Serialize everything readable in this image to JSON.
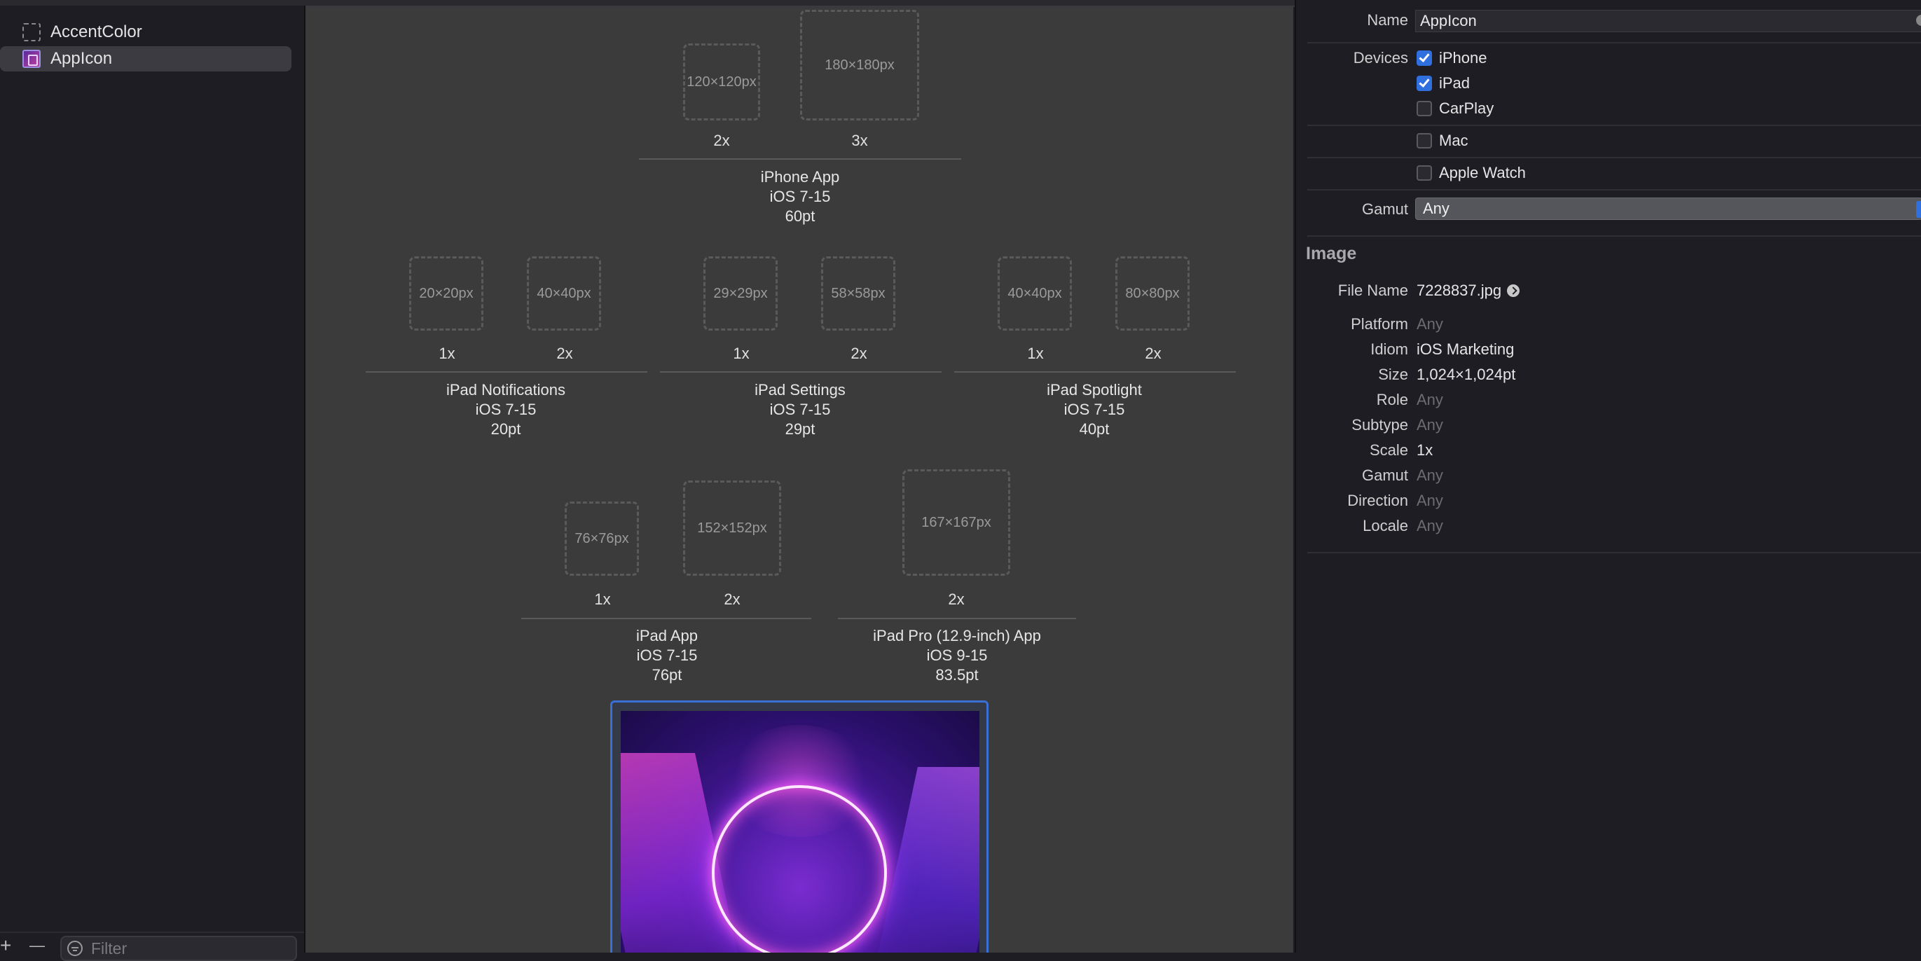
{
  "sidebar": {
    "items": [
      {
        "label": "AccentColor",
        "icon": "color-set-icon"
      },
      {
        "label": "AppIcon",
        "icon": "app-icon-set-icon"
      }
    ],
    "add": "+",
    "remove": "—",
    "filter_placeholder": "Filter"
  },
  "canvas": {
    "slots": [
      {
        "size": "120×120px",
        "scale": "2x"
      },
      {
        "size": "180×180px",
        "scale": "3x"
      },
      {
        "size": "20×20px",
        "scale": "1x"
      },
      {
        "size": "40×40px",
        "scale": "2x"
      },
      {
        "size": "29×29px",
        "scale": "1x"
      },
      {
        "size": "58×58px",
        "scale": "2x"
      },
      {
        "size": "40×40px",
        "scale": "1x"
      },
      {
        "size": "80×80px",
        "scale": "2x"
      },
      {
        "size": "76×76px",
        "scale": "1x"
      },
      {
        "size": "152×152px",
        "scale": "2x"
      },
      {
        "size": "167×167px",
        "scale": "2x"
      }
    ],
    "groups": [
      {
        "name": "iPhone App",
        "os": "iOS 7-15",
        "pt": "60pt"
      },
      {
        "name": "iPad Notifications",
        "os": "iOS 7-15",
        "pt": "20pt"
      },
      {
        "name": "iPad Settings",
        "os": "iOS 7-15",
        "pt": "29pt"
      },
      {
        "name": "iPad Spotlight",
        "os": "iOS 7-15",
        "pt": "40pt"
      },
      {
        "name": "iPad App",
        "os": "iOS 7-15",
        "pt": "76pt"
      },
      {
        "name": "iPad Pro (12.9-inch) App",
        "os": "iOS 9-15",
        "pt": "83.5pt"
      }
    ]
  },
  "inspector": {
    "name_label": "Name",
    "name_value": "AppIcon",
    "devices_label": "Devices",
    "devices": [
      {
        "label": "iPhone",
        "checked": true
      },
      {
        "label": "iPad",
        "checked": true
      },
      {
        "label": "CarPlay",
        "checked": false
      },
      {
        "label": "Mac",
        "checked": false
      },
      {
        "label": "Apple Watch",
        "checked": false
      }
    ],
    "gamut_label": "Gamut",
    "gamut_value": "Any",
    "image_section": "Image",
    "image_fields": [
      {
        "label": "File Name",
        "value": "7228837.jpg",
        "muted": false
      },
      {
        "label": "Platform",
        "value": "Any",
        "muted": true
      },
      {
        "label": "Idiom",
        "value": "iOS Marketing",
        "muted": false
      },
      {
        "label": "Size",
        "value": "1,024×1,024pt",
        "muted": false
      },
      {
        "label": "Role",
        "value": "Any",
        "muted": true
      },
      {
        "label": "Subtype",
        "value": "Any",
        "muted": true
      },
      {
        "label": "Scale",
        "value": "1x",
        "muted": false
      },
      {
        "label": "Gamut",
        "value": "Any",
        "muted": true
      },
      {
        "label": "Direction",
        "value": "Any",
        "muted": true
      },
      {
        "label": "Locale",
        "value": "Any",
        "muted": true
      }
    ]
  },
  "colors": {
    "accent": "#2f6fde",
    "selection_border": "#3a6fd8"
  }
}
